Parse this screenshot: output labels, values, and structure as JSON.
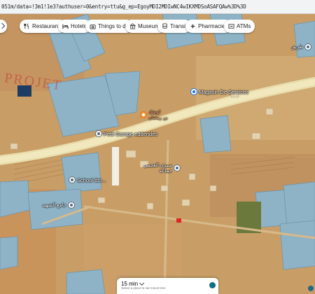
{
  "browser": {
    "url": "051m/data=!3m1!1e3?authuser=0&entry=ttu&g_ep=EgoyMDI2MDIwNC4wIKXMDSoASAFQAw%3D%3D"
  },
  "chips": [
    {
      "label": "Restaurants",
      "icon": "fork-knife-icon"
    },
    {
      "label": "Hotels",
      "icon": "bed-icon"
    },
    {
      "label": "Things to do",
      "icon": "camera-icon"
    },
    {
      "label": "Museums",
      "icon": "museum-icon"
    },
    {
      "label": "Transit",
      "icon": "bus-icon"
    },
    {
      "label": "Pharmacies",
      "icon": "pill-icon"
    },
    {
      "label": "ATMs",
      "icon": "atm-icon"
    }
  ],
  "places": {
    "magasin": "Magasin De Services",
    "koshk": "كوشك\nبن رمضان",
    "garage": "Petit Garage eddendes",
    "sidi": "سيدي العجمي\nجماعة",
    "school": "School Ibn...",
    "mosque_label": "جامع الشهيد",
    "top_right": "طريق"
  },
  "watermark": "PROJET",
  "travel_card": {
    "time": "15 min",
    "hint": "Select a place to see travel time"
  },
  "colors": {
    "desert": "#c9a06a",
    "road": "#ece3b4",
    "greenhouse": "#8fb4c9"
  }
}
